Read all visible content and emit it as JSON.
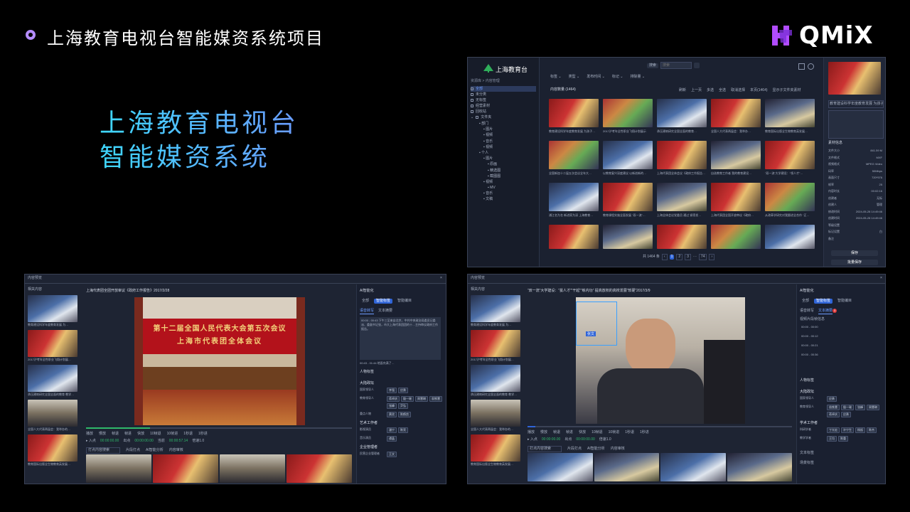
{
  "header": {
    "title": "上海教育电视台智能媒资系统项目"
  },
  "logo": {
    "text": "QMiX",
    "accent": "#b14cff"
  },
  "hero": {
    "line1": "上海教育电视台",
    "line2": "智能媒资系统"
  },
  "colors": {
    "background": "#000000",
    "accent": "#2f64d8",
    "hero_from": "#3ed8ff",
    "hero_to": "#6a9cff"
  },
  "top_window": {
    "brand": "上海教育台",
    "breadcrumb": "资源库 > 内容管理",
    "search": {
      "scope": "搜索",
      "placeholder": "搜索"
    },
    "nav": [
      "全部",
      "未分类",
      "无标签",
      "经营素材",
      "回收站",
      "文件夹"
    ],
    "tree": [
      "部门",
      "图片",
      "视频",
      "音乐",
      "视频",
      "个人",
      "图片",
      "原画",
      "精选图",
      "截图图",
      "视频",
      "MV",
      "音乐",
      "文稿"
    ],
    "filters": [
      "标签",
      "类型",
      "发布时间",
      "标记",
      "排除量"
    ],
    "count_label": "内容数量 (1464)",
    "actions": [
      "刷新",
      "上一页",
      "多选",
      "全选",
      "取消选择",
      "本页(1464)",
      "显示子文件夹素材"
    ],
    "cards": [
      "教育建设科学年度教育发展 为孩子…",
      "2017沪考年全性职业飞翔计划展示",
      "承压建筑研究全国全面的教育…",
      "全国人大代表两届会：我举办…",
      "教育国际出版全生物教育英发展…",
      "全国新加十二届五次会议全年大…",
      "以教育复兴深度建议 以新创新的…",
      "上海代表团全体会议《政府工作报告…",
      "自选教育工作者 我的教育建设…",
      "“双一流”大学建设：“领人才”…",
      "浦江名为名 新进家为深 上海教育…",
      "教育课程实施全面发展 “双一流”…",
      "上海全体会议党委员 通过 紧密发…",
      "上海代表团全国开放审议《政府…",
      "从改革学研究对我跟进全合作 “正…"
    ],
    "pagination": {
      "total": "共 1464 条",
      "pages": [
        "1",
        "2",
        "3",
        "···",
        "74"
      ]
    },
    "detail": {
      "title": "教育建设科学年度教育发展 为孩子成…",
      "section": "素材信息",
      "rows": [
        [
          "文件大小",
          "841.59 M"
        ],
        [
          "文件格式",
          "MXF"
        ],
        [
          "视频格式",
          "MPEG Video"
        ],
        [
          "码率",
          "50Mbps"
        ],
        [
          "画面尺寸",
          "720*576"
        ],
        [
          "帧率",
          "25"
        ],
        [
          "内容时长",
          "00:02:16"
        ],
        [
          "创建者",
          "无标"
        ],
        [
          "创建人",
          "管理"
        ],
        [
          "修改时间",
          "2024-05-28 14:49:46"
        ],
        [
          "创建时间",
          "2024-05-28 14:49:46"
        ],
        [
          "等级设置",
          ""
        ],
        [
          "标记设置",
          "白"
        ],
        [
          "备注",
          ""
        ]
      ],
      "save": "保存",
      "batch_save": "批量保存"
    }
  },
  "bottom_left": {
    "window_title": "内容预览",
    "related_title": "相关内容",
    "related": [
      "教育建设科学年度教育发展 为…",
      "2017沪考年全性职业飞翔计划展…",
      "承压建筑研究全国全面的教育 教学…",
      "全国人大代表两届会：我举办的…",
      "教育国际出版全生物教育英发展…"
    ],
    "video_title": "上海代表团全团开放审议《政府工作报告》2017/2/28",
    "banner_line1": "第十二届全国人民代表大会第五次会议",
    "banner_line2": "上海市代表团全体会议",
    "controls": [
      "播放",
      "慢放",
      "帧退",
      "帧进",
      "快放",
      "10帧退",
      "10帧进",
      "1秒退",
      "1秒进"
    ],
    "time_in": "00:00:00.00",
    "time_out": "00:00:00.00",
    "time_cur": "00:00:57.14",
    "rate": "倍速1.0",
    "tags_bar": [
      "打点内容搜索",
      "片段打点",
      "AI智能分析",
      "内容审核"
    ],
    "ai_title": "AI智能化",
    "ai_tabs": [
      "全部",
      "智能标签",
      "智能编目"
    ],
    "ai_subtabs": [
      "语音转写",
      "文本摘要"
    ],
    "transcript": "00:00 - 00:43  下午三至来自北京，中共中央政治局委员记委派、委副书记张，市大上海代表团团的十…主持审议政府工作报告。",
    "transcript2": "00:43 - 01:44  地面充满了…",
    "people_title": "人物标签",
    "people": {
      "group1": "大陆政坛",
      "row1_label": "国家领导人",
      "row1": [
        "李强",
        "应勇"
      ],
      "row2_label": "教育领导人",
      "row2": [
        "蒋卓庆",
        "殷一璀",
        "周慧琳",
        "翁铁慧",
        "张峰",
        "尹弘"
      ],
      "row3_label": "重点人物",
      "row3": [
        "黄欣",
        "陈鹤良"
      ],
      "group2": "艺术工作者",
      "row4_label": "影视演员",
      "row4": [
        "潘宁",
        "陈亮"
      ],
      "row5_label": "音乐演员",
      "row5": [
        "谭晶"
      ],
      "group3": "企业管理者",
      "row6_label": "民营企业管理者",
      "row6": [
        "王文"
      ]
    }
  },
  "bottom_right": {
    "window_title": "内容预览",
    "related_title": "相关内容",
    "video_title": "“双一流”大学建设：“拔人才”“干起”“练内功” 提高放权的高校发展“软硬”2017/3/9",
    "face_label": "张文",
    "times": [
      "00:00 - 00:00",
      "00:00 - 00:12",
      "00:00 - 00:21",
      "00:00 - 00:36"
    ],
    "keyframes_title": "视频片段帧信息",
    "people_title": "人物标签",
    "people": {
      "group1": "大陆政坛",
      "row1_label": "国家领导人",
      "row1": [
        "应勇"
      ],
      "row2_label": "教育领导人",
      "row2": [
        "翁铁慧",
        "殷一璀",
        "张峰",
        "周慧琳"
      ],
      "row2b": [
        "蒋卓庆",
        "应勇"
      ],
      "group2": "学术工作者",
      "row3_label": "科研学者",
      "row3": [
        "丁光宏",
        "许宁生",
        "杨振",
        "陈杰"
      ],
      "row4_label": "教学学者",
      "row4": [
        "王均",
        "陈重"
      ]
    },
    "ocr_title": "文本标签",
    "scene_title": "场景标签",
    "badge": "3"
  }
}
